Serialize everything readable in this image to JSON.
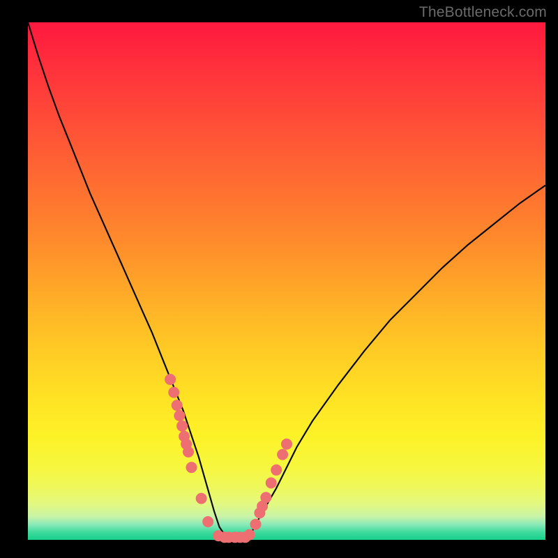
{
  "watermark": "TheBottleneck.com",
  "colors": {
    "background": "#000000",
    "dot": "#ed6f71",
    "curve": "#0a0a0a"
  },
  "chart_data": {
    "type": "line",
    "title": "",
    "xlabel": "",
    "ylabel": "",
    "xlim": [
      0,
      100
    ],
    "ylim": [
      0,
      100
    ],
    "x": [
      0,
      2,
      4,
      6,
      8,
      10,
      12,
      14,
      16,
      18,
      20,
      22,
      24,
      26,
      28,
      30,
      31,
      32,
      33,
      34,
      35,
      36,
      37,
      38,
      39,
      40,
      41,
      42,
      43,
      44,
      46,
      48,
      50,
      52,
      55,
      60,
      65,
      70,
      75,
      80,
      85,
      90,
      95,
      100
    ],
    "y": [
      100,
      93.5,
      87.5,
      82,
      77,
      72,
      67,
      62.5,
      58,
      53.5,
      49,
      44.5,
      40,
      35,
      30,
      25,
      22,
      19,
      16,
      12.5,
      9,
      5.5,
      2.5,
      1,
      0.5,
      0.5,
      0.5,
      0.5,
      1,
      3,
      6.5,
      10,
      14,
      18,
      23,
      30,
      36.5,
      42.5,
      47.5,
      52.5,
      57,
      61,
      65,
      68.5
    ],
    "dots": {
      "x": [
        27.5,
        28.2,
        28.8,
        29.3,
        29.8,
        30.2,
        30.6,
        31.0,
        31.6,
        33.5,
        34.8,
        36.8,
        38.0,
        38.8,
        40.0,
        41.0,
        42.0,
        42.8,
        44.0,
        44.8,
        45.3,
        46.0,
        47.0,
        48.0,
        49.2,
        50.0
      ],
      "y": [
        31.0,
        28.5,
        26.0,
        24.0,
        22.0,
        20.0,
        18.5,
        17.0,
        14.0,
        8.0,
        3.5,
        0.8,
        0.5,
        0.5,
        0.5,
        0.5,
        0.5,
        1.0,
        3.0,
        5.2,
        6.5,
        8.2,
        11.0,
        13.5,
        16.5,
        18.5
      ]
    }
  }
}
